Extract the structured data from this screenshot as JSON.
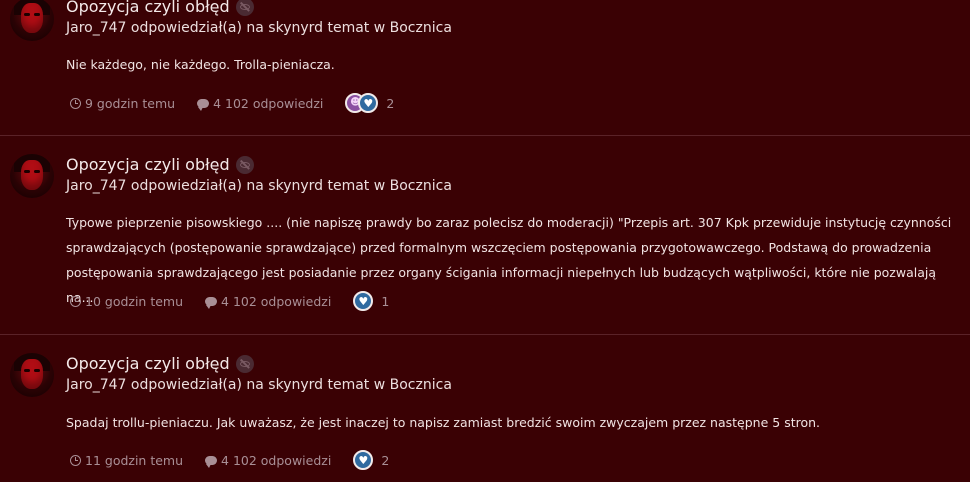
{
  "posts": [
    {
      "title": "Opozycja czyli obłęd",
      "meta": "Jaro_747 odpowiedział(a) na skynyrd temat w Bocznica",
      "body": "Nie każdego, nie każdego. Trolla-pieniacza.",
      "time": "9 godzin temu",
      "replies": "4 102 odpowiedzi",
      "reaction_count": "2",
      "reaction_icons": [
        "emoji-icon",
        "heart-icon"
      ]
    },
    {
      "title": "Opozycja czyli obłęd",
      "meta": "Jaro_747 odpowiedział(a) na skynyrd temat w Bocznica",
      "body": "Typowe pieprzenie pisowskiego .... (nie napiszę prawdy bo zaraz polecisz do moderacji) \"Przepis art. 307 Kpk przewiduje instytucję czynności sprawdzających (postępowanie sprawdzające) przed formalnym wszczęciem postępowania przygotowawczego. Podstawą do prowadzenia postępowania sprawdzającego jest posiadanie przez organy ścigania informacji niepełnych lub budzących wątpliwości, które nie pozwalają na...",
      "time": "10 godzin temu",
      "replies": "4 102 odpowiedzi",
      "reaction_count": "1",
      "reaction_icons": [
        "heart-icon"
      ]
    },
    {
      "title": "Opozycja czyli obłęd",
      "meta": "Jaro_747 odpowiedział(a) na skynyrd temat w Bocznica",
      "body": "Spadaj trollu-pieniaczu. Jak uważasz, że jest inaczej to napisz zamiast bredzić swoim zwyczajem przez następne 5 stron.",
      "time": "11 godzin temu",
      "replies": "4 102 odpowiedzi",
      "reaction_count": "2",
      "reaction_icons": [
        "heart-icon"
      ]
    }
  ],
  "colors": {
    "background": "#3a0104",
    "divider": "#5a2228",
    "muted": "#a98f96",
    "like": "#2f6aa0"
  }
}
